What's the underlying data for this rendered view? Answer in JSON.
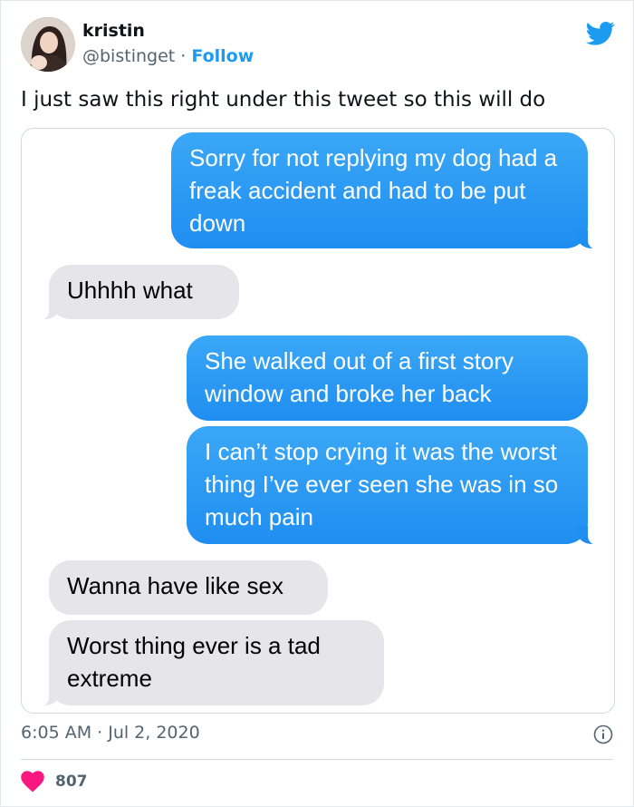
{
  "author": {
    "name": "kristin",
    "handle": "@bistinget",
    "separator": "·",
    "follow_label": "Follow"
  },
  "icons": {
    "brand": "twitter-bird-icon",
    "info": "info-icon",
    "like": "heart-icon"
  },
  "colors": {
    "accent": "#1d9bf0",
    "outgoing_bubble": "#2b9af3",
    "incoming_bubble": "#e6e5ea",
    "heart": "#f91880"
  },
  "tweet": {
    "text": "I just saw this right under this tweet so this will do"
  },
  "messages": [
    {
      "direction": "out",
      "text": "Sorry for not replying my dog had a freak accident and had to be put down"
    },
    {
      "direction": "in",
      "text": "Uhhhh what"
    },
    {
      "direction": "out",
      "text": "She walked out of a first story window and broke her back"
    },
    {
      "direction": "out",
      "text": "I can’t stop crying it was the worst thing I’ve ever seen she was in so much pain"
    },
    {
      "direction": "in",
      "text": "Wanna have like sex"
    },
    {
      "direction": "in",
      "text": "Worst thing ever is a tad extreme"
    }
  ],
  "footer": {
    "timestamp": "6:05 AM · Jul 2, 2020",
    "like_count": "807"
  }
}
